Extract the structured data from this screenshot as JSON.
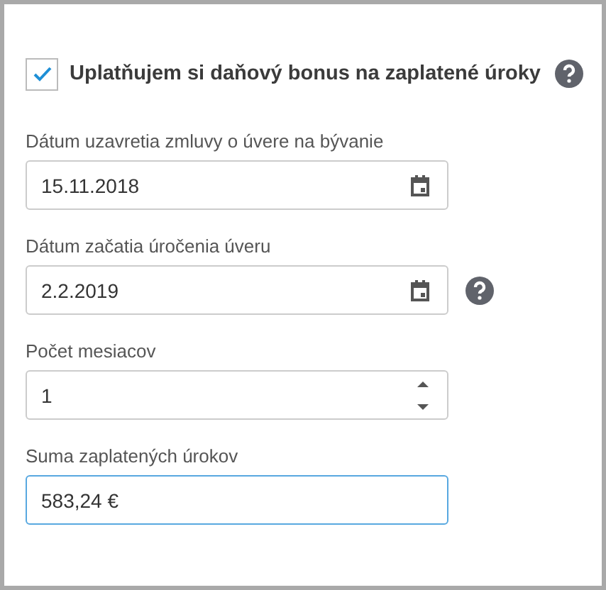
{
  "bonus_checkbox": {
    "label": "Uplatňujem si daňový bonus na zaplatené úroky",
    "checked": true,
    "help": true
  },
  "fields": [
    {
      "kind": "date",
      "label": "Dátum uzavretia zmluvy o úvere na bývanie",
      "value": "15.11.2018",
      "help": false,
      "focused": false
    },
    {
      "kind": "date",
      "label": "Dátum začatia úročenia úveru",
      "value": "2.2.2019",
      "help": true,
      "focused": false
    },
    {
      "kind": "number",
      "label": "Počet mesiacov",
      "value": "1",
      "help": false,
      "focused": false
    },
    {
      "kind": "text",
      "label": "Suma zaplatených úrokov",
      "value": "583,24 €",
      "help": false,
      "focused": true
    }
  ]
}
